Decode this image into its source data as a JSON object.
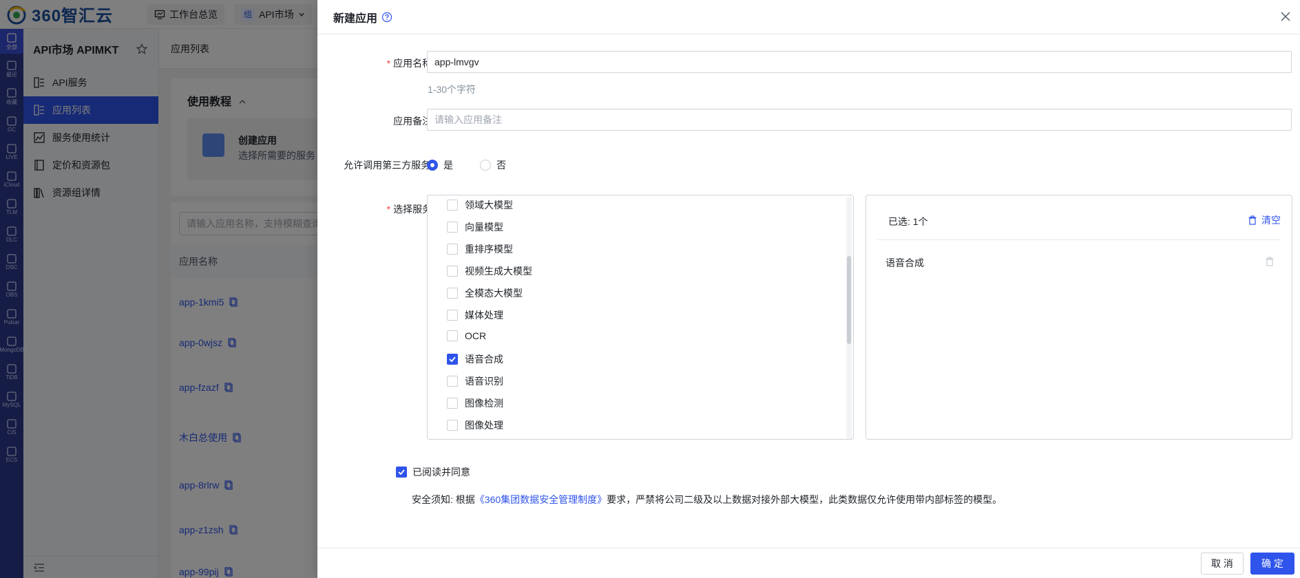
{
  "topbar": {
    "logo_text": "360智汇云",
    "workspace_label": "工作台总览",
    "group_badge": "组",
    "market_label": "API市场"
  },
  "rail": {
    "items": [
      "全部",
      "最近",
      "收藏",
      "GC",
      "LIVE",
      "iCloud",
      "TLM",
      "DLC",
      "DSC",
      "OBS",
      "Pulsar",
      "MongoDB",
      "TiDB",
      "MySQL",
      "CIS",
      "ECS"
    ]
  },
  "sidebar": {
    "title": "API市场 APIMKT",
    "items": [
      {
        "label": "API服务",
        "icon": "api-service-icon"
      },
      {
        "label": "应用列表",
        "icon": "app-list-icon"
      },
      {
        "label": "服务使用统计",
        "icon": "chart-icon"
      },
      {
        "label": "定价和资源包",
        "icon": "book-icon"
      },
      {
        "label": "资源组详情",
        "icon": "library-icon"
      }
    ]
  },
  "page": {
    "header": "应用列表",
    "tutorial_title": "使用教程",
    "tutorial_card_title": "创建应用",
    "tutorial_card_sub": "选择所需要的服务",
    "search_placeholder": "请输入应用名称，支持模糊查询",
    "column_name": "应用名称",
    "apps": [
      "app-1kmi5",
      "app-0wjsz",
      "app-fzazf",
      "木白总使用",
      "app-8rlrw",
      "app-z1zsh",
      "app-99pij"
    ]
  },
  "drawer": {
    "title": "新建应用",
    "name_label": "应用名称:",
    "name_value": "app-lmvgv",
    "name_hint": "1-30个字符",
    "note_label": "应用备注:",
    "note_placeholder": "请输入应用备注",
    "third_party_label": "允许调用第三方服务:",
    "radio_yes": "是",
    "radio_no": "否",
    "service_label": "选择服务:",
    "services": [
      {
        "label": "领域大模型",
        "checked": false
      },
      {
        "label": "向量模型",
        "checked": false
      },
      {
        "label": "重排序模型",
        "checked": false
      },
      {
        "label": "视频生成大模型",
        "checked": false
      },
      {
        "label": "全模态大模型",
        "checked": false
      },
      {
        "label": "媒体处理",
        "checked": false
      },
      {
        "label": "OCR",
        "checked": false
      },
      {
        "label": "语音合成",
        "checked": true
      },
      {
        "label": "语音识别",
        "checked": false
      },
      {
        "label": "图像检测",
        "checked": false
      },
      {
        "label": "图像处理",
        "checked": false
      }
    ],
    "selected_count_label": "已选: 1个",
    "clear_label": "清空",
    "selected_items": [
      "语音合成"
    ],
    "agree_label": "已阅读并同意",
    "notice_prefix": "安全须知: 根据",
    "notice_link": "《360集团数据安全管理制度》",
    "notice_suffix": "要求，严禁将公司二级及以上数据对接外部大模型，此类数据仅允许使用带内部标签的模型。",
    "cancel_label": "取 消",
    "ok_label": "确 定"
  },
  "colors": {
    "primary": "#2f54eb",
    "rail": "#2b3a8c",
    "required": "#f53f3f"
  }
}
